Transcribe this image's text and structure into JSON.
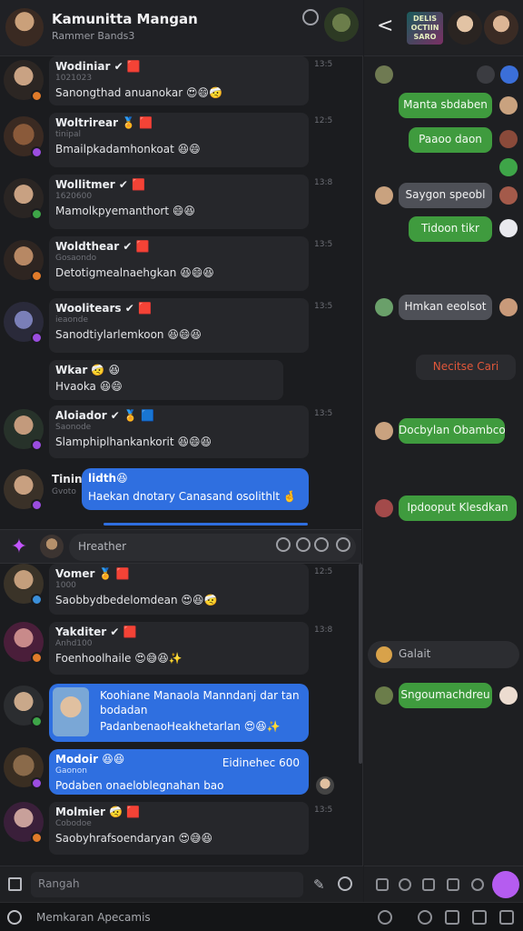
{
  "header": {
    "title": "Kamunitta Mangan",
    "subtitle": "Rammer Bands3"
  },
  "feed": [
    {
      "name": "Wodiniar",
      "meta": "1021023",
      "msg": "Sanongthad anuanokar",
      "emoji": "😍😄🤕",
      "time": "13:5",
      "badge": "#e07b2a",
      "tags": "✔ 🟥"
    },
    {
      "name": "Woltrirear",
      "meta": "tinipal",
      "msg": "Bmailpkadamhonkoat",
      "emoji": "😆😄",
      "time": "12:5",
      "badge": "#9b4de0",
      "tags": "🏅 🟥"
    },
    {
      "name": "Wollitmer",
      "meta": "1620600",
      "msg": "Mamolkpyemanthort",
      "emoji": "😄😆",
      "time": "13:8",
      "badge": "#3ea548",
      "tags": "✔ 🟥"
    },
    {
      "name": "Woldthear",
      "meta": "Gosaondo",
      "msg": "Detotigmealnaehgkan",
      "emoji": "😆😄😆",
      "time": "13:5",
      "badge": "#e07b2a",
      "tags": "✔ 🟥"
    },
    {
      "name": "Woolitears",
      "meta": "ieaonde",
      "msg": "Sanodtiylarlemkoon",
      "emoji": "😆😄😆",
      "time": "13:5",
      "badge": "#9b4de0",
      "tags": "✔ 🟥"
    },
    {
      "name": "Wkar",
      "meta": "",
      "msg": "Hvaoka",
      "emoji": "😆😄",
      "time": "",
      "badge": "",
      "tags": "🤕 😆"
    },
    {
      "name": "Aloiador",
      "meta": "Saonode",
      "msg": "Slamphiplhankankorit",
      "emoji": "😆😄😆",
      "time": "13:5",
      "badge": "#9b4de0",
      "tags": "✔ 🏅 🟦"
    },
    {
      "name": "Tinin",
      "meta": "Gvoto",
      "msg": "",
      "emoji": "",
      "time": "",
      "badge": "#9b4de0",
      "tags": ""
    }
  ],
  "blue_msg": {
    "title": "lidth😆",
    "text": "Haekan dnotary Canasand osolithlt",
    "emoji": "🤞"
  },
  "compose_mid": {
    "placeholder": "Hreather"
  },
  "feed2": [
    {
      "name": "Vomer",
      "meta": "1000",
      "msg": "Saobbydbedelomdean",
      "emoji": "😍😆🤕",
      "time": "12:5",
      "badge": "#3b8fd9",
      "tags": "🏅 🟥"
    },
    {
      "name": "Yakditer",
      "meta": "Anhd100",
      "msg": "Foenhoolhaile",
      "emoji": "😍😅😆✨",
      "time": "13:8",
      "badge": "#e07b2a",
      "tags": "✔ 🟥"
    },
    {
      "name": "Molmier",
      "meta": "Cobodoe",
      "msg": "Saobyhrafsoendaryan",
      "emoji": "😍😅😆",
      "time": "13:5",
      "badge": "#e07b2a",
      "tags": "🤕 🟥"
    }
  ],
  "blue2": {
    "text1": "Koohiane Manaola Manndanj dar tan",
    "text2": "bodadan",
    "text3": "PadanbenaoHeakhetarlan",
    "emoji": "😍😆✨"
  },
  "blue3": {
    "name": "Modoir",
    "meta": "Gaonon",
    "right": "Eidinehec 600",
    "text": "Podaben onaeloblegnahan bao",
    "emoji": "😆😆"
  },
  "bottom_input": {
    "placeholder": "Rangah"
  },
  "footer": {
    "label": "Memkaran Apecamis"
  },
  "right": {
    "logo": "DELIS OCTIIN SARO",
    "bubbles": [
      {
        "text": "Manta sbdaben",
        "style": "g"
      },
      {
        "text": "Paaoo daon",
        "style": "g"
      },
      {
        "text": "Saygon speobl",
        "style": "d"
      },
      {
        "text": "Tidoon tikr",
        "style": "g"
      },
      {
        "text": "Hmkan eeolsot",
        "style": "d"
      },
      {
        "text": "Necitse Cari",
        "style": "o"
      },
      {
        "text": "Docbylan Obambco",
        "style": "g"
      },
      {
        "text": "Ipdooput Klesdkan",
        "style": "g"
      },
      {
        "text": "Sngoumachdreu",
        "style": "g"
      }
    ],
    "compose": {
      "placeholder": "Galait"
    }
  },
  "colors": {
    "accent_green": "#3f9b3e",
    "accent_blue": "#2f6fe0",
    "send_purple": "#b55cf0"
  }
}
